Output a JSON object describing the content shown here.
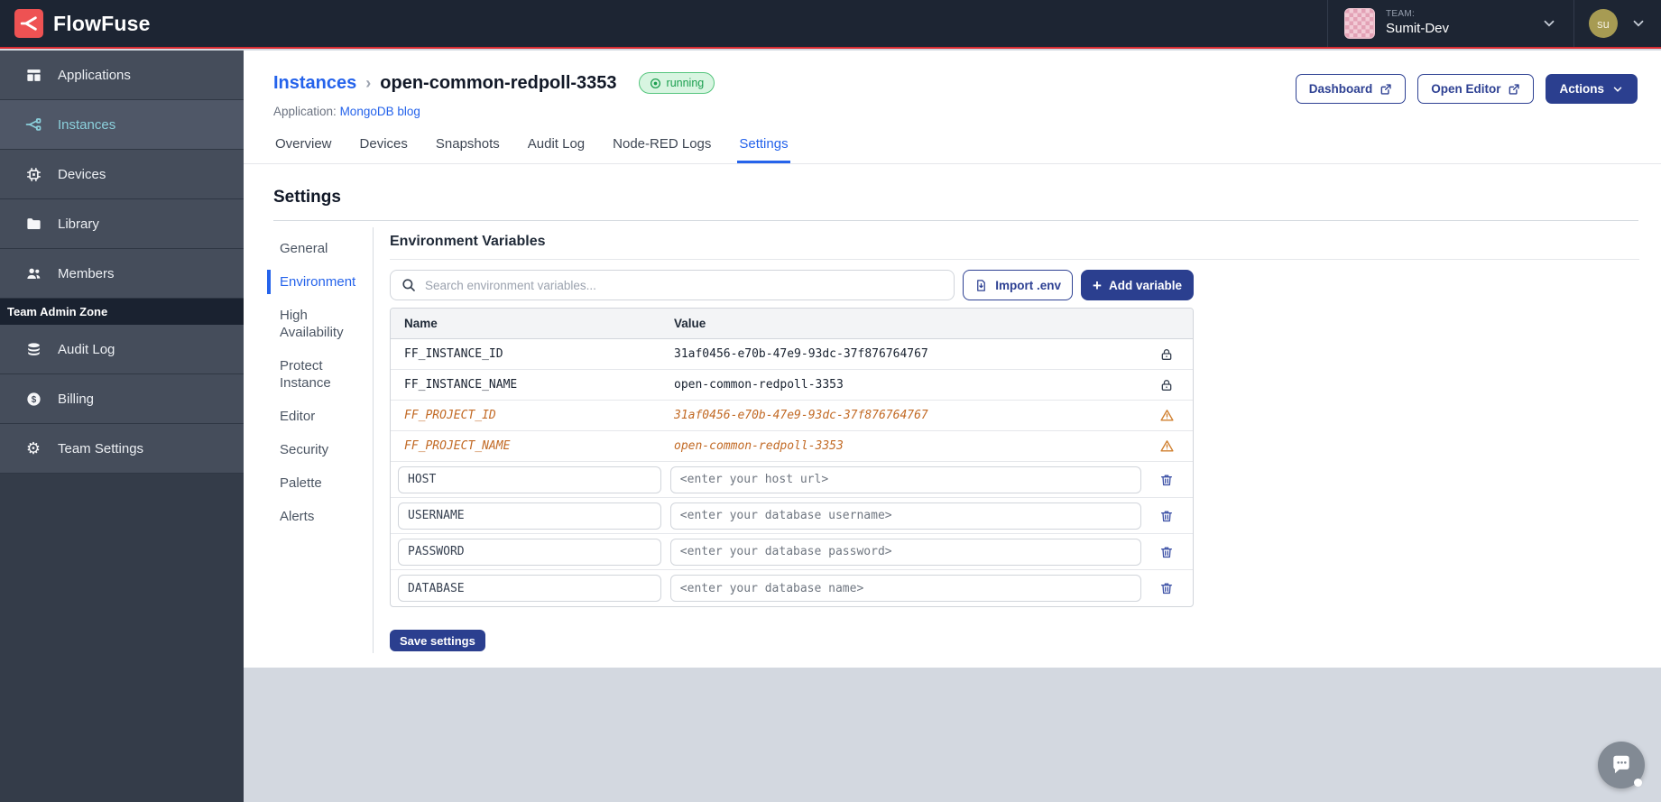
{
  "colors": {
    "navbar_bg": "#1d2533",
    "brand_red": "#ee5253",
    "accent_red_line": "#d92b31",
    "sidebar_item_bg": "#454d5b",
    "sidebar_active_text": "#8bd0dc",
    "link_blue": "#2563eb",
    "primary_navy": "#2b3f8f",
    "status_green_text": "#1b9e4f",
    "status_green_bg": "#d8f5e1",
    "deprecated_orange": "#c26a25"
  },
  "navbar": {
    "brand": "FlowFuse",
    "team_label": "TEAM:",
    "team_name": "Sumit-Dev",
    "user_initials": "su"
  },
  "sidebar": {
    "items": [
      {
        "label": "Applications"
      },
      {
        "label": "Instances"
      },
      {
        "label": "Devices"
      },
      {
        "label": "Library"
      },
      {
        "label": "Members"
      }
    ],
    "admin_zone_label": "Team Admin Zone",
    "admin_items": [
      {
        "label": "Audit Log"
      },
      {
        "label": "Billing"
      },
      {
        "label": "Team Settings"
      }
    ]
  },
  "header": {
    "breadcrumb_parent": "Instances",
    "breadcrumb_separator": "›",
    "breadcrumb_current": "open-common-redpoll-3353",
    "status_badge": "running",
    "application_label": "Application:",
    "application_name": "MongoDB blog",
    "dashboard_button": "Dashboard",
    "open_editor_button": "Open Editor",
    "actions_button": "Actions",
    "tabs": [
      "Overview",
      "Devices",
      "Snapshots",
      "Audit Log",
      "Node-RED Logs",
      "Settings"
    ],
    "active_tab": "Settings"
  },
  "settings": {
    "title": "Settings",
    "nav": [
      "General",
      "Environment",
      "High Availability",
      "Protect Instance",
      "Editor",
      "Security",
      "Palette",
      "Alerts"
    ],
    "active_nav": "Environment"
  },
  "env_panel": {
    "title": "Environment Variables",
    "search_placeholder": "Search environment variables...",
    "import_button": "Import .env",
    "add_button": "Add variable",
    "columns": {
      "name": "Name",
      "value": "Value"
    },
    "locked_rows": [
      {
        "name": "FF_INSTANCE_ID",
        "value": "31af0456-e70b-47e9-93dc-37f876764767"
      },
      {
        "name": "FF_INSTANCE_NAME",
        "value": "open-common-redpoll-3353"
      }
    ],
    "deprecated_rows": [
      {
        "name": "FF_PROJECT_ID",
        "value": "31af0456-e70b-47e9-93dc-37f876764767"
      },
      {
        "name": "FF_PROJECT_NAME",
        "value": "open-common-redpoll-3353"
      }
    ],
    "editable_rows": [
      {
        "name": "HOST",
        "value_placeholder": "<enter your host url>"
      },
      {
        "name": "USERNAME",
        "value_placeholder": "<enter your database username>"
      },
      {
        "name": "PASSWORD",
        "value_placeholder": "<enter your database password>"
      },
      {
        "name": "DATABASE",
        "value_placeholder": "<enter your database name>"
      }
    ],
    "save_button": "Save settings"
  }
}
